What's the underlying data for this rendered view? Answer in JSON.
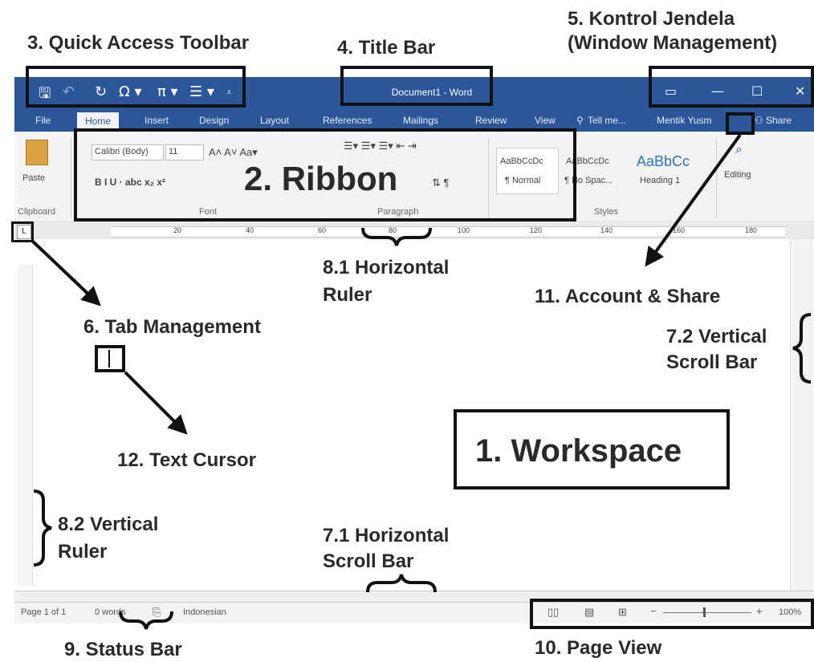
{
  "annotations": {
    "quick_access": "3. Quick Access Toolbar",
    "title_bar": "4. Title Bar",
    "window_control_line1": "5. Kontrol Jendela",
    "window_control_line2": "(Window Management)",
    "ribbon": "2. Ribbon",
    "h_ruler_line1": "8.1 Horizontal",
    "h_ruler_line2": "Ruler",
    "account_share": "11. Account & Share",
    "tab_management": "6. Tab Management",
    "v_scroll_line1": "7.2 Vertical",
    "v_scroll_line2": "Scroll Bar",
    "text_cursor": "12. Text Cursor",
    "workspace": "1. Workspace",
    "v_ruler_line1": "8.2 Vertical",
    "v_ruler_line2": "Ruler",
    "h_scroll_line1": "7.1 Horizontal",
    "h_scroll_line2": "Scroll Bar",
    "status_bar": "9. Status Bar",
    "page_view": "10. Page View"
  },
  "window": {
    "title": "Document1 - Word",
    "quick_access_icons": [
      "save-icon",
      "undo-icon",
      "redo-icon",
      "omega-icon",
      "pi-icon",
      "list-icon",
      "customize-icon"
    ],
    "tabs": [
      "File",
      "Home",
      "Insert",
      "Design",
      "Layout",
      "References",
      "Mailings",
      "Review",
      "View"
    ],
    "tell_me": "Tell me...",
    "user": "Mentik Yusm",
    "share": "Share"
  },
  "ribbon": {
    "paste": "Paste",
    "font_name": "Calibri (Body)",
    "font_size": "11",
    "font_buttons": "B  I  U  · abc  x₂  x²",
    "group_clipboard": "Clipboard",
    "group_font": "Font",
    "group_paragraph": "Paragraph",
    "group_styles": "Styles",
    "style1_sample": "AaBbCcDc",
    "style1_name": "¶ Normal",
    "style2_sample": "AaBbCcDc",
    "style2_name": "¶ No Spac...",
    "style3_sample": "AaBbCc",
    "style3_name": "Heading 1",
    "editing": "Editing"
  },
  "ruler": {
    "marks": [
      "20",
      "40",
      "60",
      "80",
      "100",
      "120",
      "140",
      "160",
      "180"
    ]
  },
  "status": {
    "page": "Page 1 of 1",
    "words": "0 words",
    "language": "Indonesian",
    "zoom": "100%"
  },
  "colors": {
    "word_blue": "#2b579a",
    "ribbon_bg": "#f3f3f3"
  }
}
